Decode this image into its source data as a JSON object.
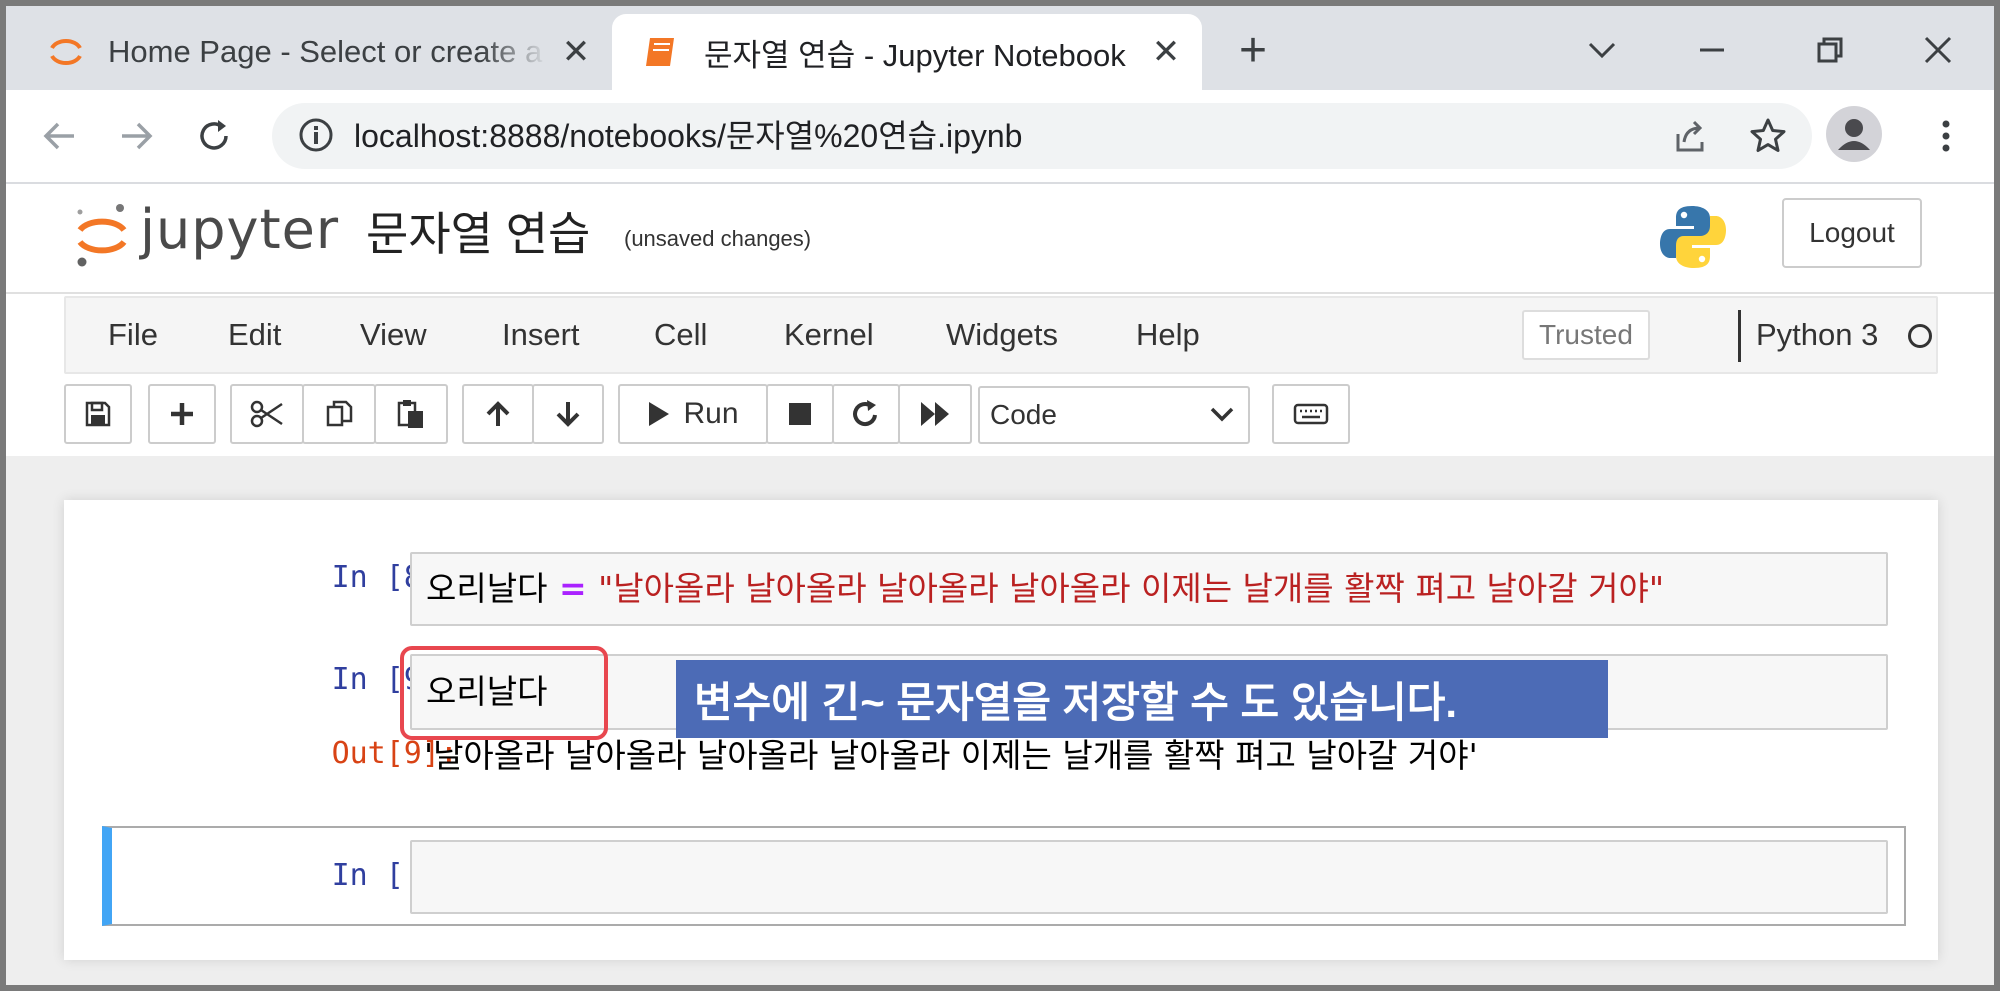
{
  "browser": {
    "tabs": [
      {
        "title": "Home Page - Select or create a notebook",
        "active": false
      },
      {
        "title": "문자열 연습 - Jupyter Notebook",
        "active": true
      }
    ],
    "url": "localhost:8888/notebooks/문자열%20연습.ipynb"
  },
  "jupyter": {
    "logo_text": "jupyter",
    "notebook_name": "문자열 연습",
    "save_status": "(unsaved changes)",
    "logout_label": "Logout",
    "menu": [
      "File",
      "Edit",
      "View",
      "Insert",
      "Cell",
      "Kernel",
      "Widgets",
      "Help"
    ],
    "trusted_label": "Trusted",
    "kernel_name": "Python 3",
    "toolbar": {
      "run_label": "Run",
      "cell_type": "Code"
    }
  },
  "cells": [
    {
      "prompt": "In [8]:",
      "code_var": "오리날다",
      "code_op": " = ",
      "code_str": "\"날아올라 날아올라 날아올라 날아올라 이제는 날개를 활짝 펴고 날아갈 거야\""
    },
    {
      "prompt": "In [9]:",
      "code": "오리날다",
      "out_prompt": "Out[9]:",
      "output": "'날아올라 날아올라 날아올라 날아올라 이제는 날개를 활짝 펴고 날아갈 거야'"
    },
    {
      "prompt": "In [ ]:",
      "code": ""
    }
  ],
  "annotation": {
    "text": "변수에 긴~ 문자열을 저장할 수 도 있습니다.",
    "highlight_color": "#e8474f",
    "callout_color": "#4c6bb6"
  }
}
